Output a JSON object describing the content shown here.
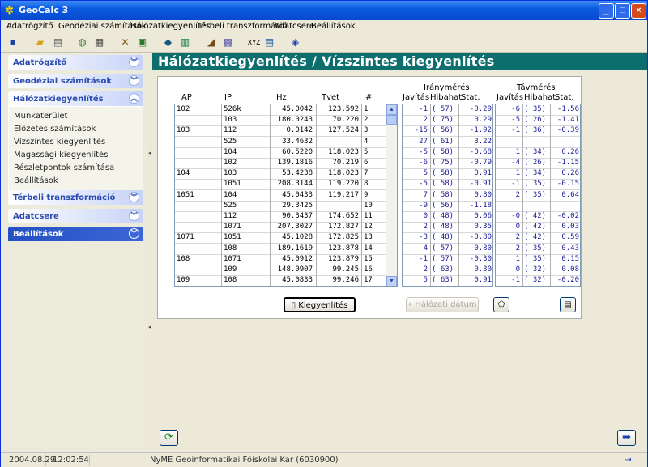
{
  "window": {
    "title": "GeoCalc 3",
    "minimize": "_",
    "maximize": "□",
    "close": "×"
  },
  "menu": [
    "Adatrögzítő",
    "Geodéziai számítások",
    "Hálózatkiegyenlítés",
    "Térbeli transzformáció",
    "Adatcsere",
    "Beállítások"
  ],
  "sidebar": {
    "panels": [
      {
        "title": "Adatrögzítő",
        "items": []
      },
      {
        "title": "Geodéziai számítások",
        "items": []
      },
      {
        "title": "Hálózatkiegyenlítés",
        "items": [
          "Munkaterület",
          "Előzetes számítások",
          "Vízszintes kiegyenlítés",
          "Magassági kiegyenlítés",
          "Részletpontok számítása",
          "Beállítások"
        ]
      },
      {
        "title": "Térbeli transzformáció",
        "items": []
      },
      {
        "title": "Adatcsere",
        "items": []
      },
      {
        "title": "Beállítások",
        "items": []
      }
    ]
  },
  "main": {
    "heading": "Hálózatkiegyenlítés / Vízszintes kiegyenlítés",
    "left_headers": [
      "AP",
      "IP",
      "Hz",
      "Tvet",
      "#"
    ],
    "irany_title": "Iránymérés",
    "tav_title": "Távmérés",
    "sub_headers": [
      "Javítás",
      "Hibahat.",
      "Stat."
    ],
    "rows": [
      {
        "ap": "102",
        "ip": "526k",
        "hz": "45.0042",
        "tvet": "123.592",
        "n": "1",
        "ij": "-1",
        "ih": "( 57)",
        "is": "-0.29",
        "tj": "-6",
        "th": "( 35)",
        "ts": "-1.56"
      },
      {
        "ap": "",
        "ip": "103",
        "hz": "180.0243",
        "tvet": "70.220",
        "n": "2",
        "ij": "2",
        "ih": "( 75)",
        "is": "0.29",
        "tj": "-5",
        "th": "( 26)",
        "ts": "-1.41"
      },
      {
        "ap": "103",
        "ip": "112",
        "hz": "0.0142",
        "tvet": "127.524",
        "n": "3",
        "ij": "-15",
        "ih": "( 56)",
        "is": "-1.92",
        "tj": "-1",
        "th": "( 36)",
        "ts": "-0.39"
      },
      {
        "ap": "",
        "ip": "525",
        "hz": "33.4632",
        "tvet": "",
        "n": "4",
        "ij": "27",
        "ih": "( 61)",
        "is": "3.22",
        "tj": "",
        "th": "",
        "ts": ""
      },
      {
        "ap": "",
        "ip": "104",
        "hz": "60.5220",
        "tvet": "118.023",
        "n": "5",
        "ij": "-5",
        "ih": "( 58)",
        "is": "-0.68",
        "tj": "1",
        "th": "( 34)",
        "ts": "0.26"
      },
      {
        "ap": "",
        "ip": "102",
        "hz": "139.1816",
        "tvet": "70.219",
        "n": "6",
        "ij": "-6",
        "ih": "( 75)",
        "is": "-0.79",
        "tj": "-4",
        "th": "( 26)",
        "ts": "-1.15"
      },
      {
        "ap": "104",
        "ip": "103",
        "hz": "53.4238",
        "tvet": "118.023",
        "n": "7",
        "ij": "5",
        "ih": "( 58)",
        "is": "0.91",
        "tj": "1",
        "th": "( 34)",
        "ts": "0.26"
      },
      {
        "ap": "",
        "ip": "1051",
        "hz": "208.3144",
        "tvet": "119.220",
        "n": "8",
        "ij": "-5",
        "ih": "( 58)",
        "is": "-0.91",
        "tj": "-1",
        "th": "( 35)",
        "ts": "-0.15"
      },
      {
        "ap": "1051",
        "ip": "104",
        "hz": "45.0433",
        "tvet": "119.217",
        "n": "9",
        "ij": "7",
        "ih": "( 58)",
        "is": "0.80",
        "tj": "2",
        "th": "( 35)",
        "ts": "0.64"
      },
      {
        "ap": "",
        "ip": "525",
        "hz": "29.3425",
        "tvet": "",
        "n": "10",
        "ij": "-9",
        "ih": "( 56)",
        "is": "-1.18",
        "tj": "",
        "th": "",
        "ts": ""
      },
      {
        "ap": "",
        "ip": "112",
        "hz": "90.3437",
        "tvet": "174.652",
        "n": "11",
        "ij": "0",
        "ih": "( 48)",
        "is": "0.06",
        "tj": "-0",
        "th": "( 42)",
        "ts": "-0.02"
      },
      {
        "ap": "",
        "ip": "1071",
        "hz": "207.3027",
        "tvet": "172.827",
        "n": "12",
        "ij": "2",
        "ih": "( 48)",
        "is": "0.35",
        "tj": "0",
        "th": "( 42)",
        "ts": "0.03"
      },
      {
        "ap": "1071",
        "ip": "1051",
        "hz": "45.1028",
        "tvet": "172.825",
        "n": "13",
        "ij": "-3",
        "ih": "( 48)",
        "is": "-0.80",
        "tj": "2",
        "th": "( 42)",
        "ts": "0.59"
      },
      {
        "ap": "",
        "ip": "108",
        "hz": "189.1619",
        "tvet": "123.878",
        "n": "14",
        "ij": "4",
        "ih": "( 57)",
        "is": "0.80",
        "tj": "2",
        "th": "( 35)",
        "ts": "0.43"
      },
      {
        "ap": "108",
        "ip": "1071",
        "hz": "45.0912",
        "tvet": "123.879",
        "n": "15",
        "ij": "-1",
        "ih": "( 57)",
        "is": "-0.30",
        "tj": "1",
        "th": "( 35)",
        "ts": "0.15"
      },
      {
        "ap": "",
        "ip": "109",
        "hz": "148.0907",
        "tvet": "99.245",
        "n": "16",
        "ij": "2",
        "ih": "( 63)",
        "is": "0.30",
        "tj": "0",
        "th": "( 32)",
        "ts": "0.08"
      },
      {
        "ap": "109",
        "ip": "108",
        "hz": "45.0833",
        "tvet": "99.246",
        "n": "17",
        "ij": "5",
        "ih": "( 63)",
        "is": "0.91",
        "tj": "-1",
        "th": "( 32)",
        "ts": "-0.20"
      }
    ],
    "btn_kiegyenlites": "Kiegyenlítés",
    "btn_halozati_datum": "Hálózati dátum"
  },
  "status": {
    "date": "2004.08.29",
    "time": "12:02:54",
    "org": "NyME Geoinformatikai Főiskolai Kar (6030900)"
  },
  "colors": {
    "heading_bg": "#0d6e6e",
    "title_bg": "#0a5be0",
    "value_blue": "#1a1a9a"
  }
}
